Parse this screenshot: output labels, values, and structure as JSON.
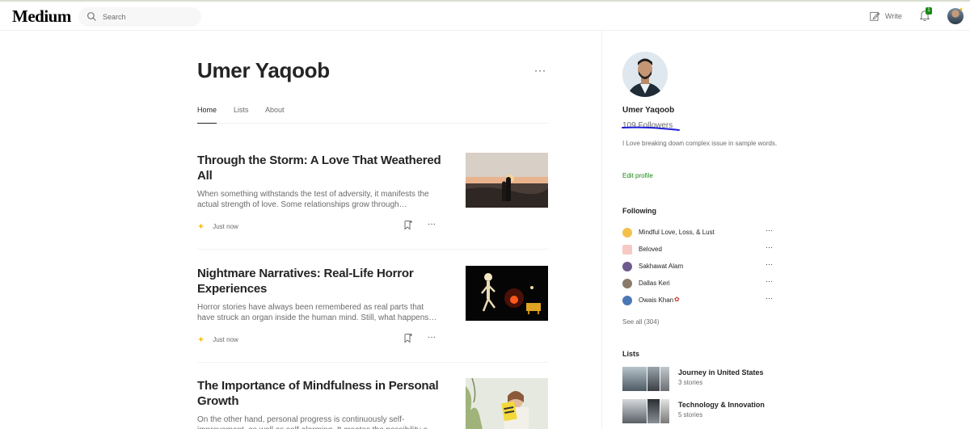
{
  "app": {
    "logo": "Medium"
  },
  "search": {
    "placeholder": "Search"
  },
  "header": {
    "write_label": "Write",
    "notification_count": "1"
  },
  "profile": {
    "name": "Umer Yaqoob",
    "more": "···",
    "tabs": [
      {
        "label": "Home",
        "active": true
      },
      {
        "label": "Lists",
        "active": false
      },
      {
        "label": "About",
        "active": false
      }
    ]
  },
  "posts": [
    {
      "title": "Through the Storm: A Love That Weathered All",
      "excerpt": "When something withstands the test of adversity, it manifests the actual strength of love. Some relationships grow through…",
      "time": "Just now"
    },
    {
      "title": "Nightmare Narratives: Real-Life Horror Experiences",
      "excerpt": "Horror stories have always been remembered as real parts that have struck an organ inside the human mind. Still, what happens…",
      "time": "Just now"
    },
    {
      "title": "The Importance of Mindfulness in Personal Growth",
      "excerpt": "On the other hand, personal progress is continuously self-improvement, as well as self-alarming. It creates the possibility o…",
      "time": ""
    }
  ],
  "post_more": "···",
  "sidebar": {
    "name": "Umer Yaqoob",
    "followers": "109 Followers",
    "bio": "I Love breaking down complex issue in sample words.",
    "edit_profile": "Edit profile",
    "following_heading": "Following",
    "following": [
      {
        "name": "Mindful Love, Loss, & Lust",
        "color": "#f5c04a"
      },
      {
        "name": "Beloved",
        "color": "#f6c9c4"
      },
      {
        "name": "Sakhawat Alam",
        "color": "#6e5a8c"
      },
      {
        "name": "Dallas Keri",
        "color": "#8a7a6a"
      },
      {
        "name": "Owais Khan",
        "color": "#4a78b5"
      }
    ],
    "see_all": "See all (304)",
    "lists_heading": "Lists",
    "lists": [
      {
        "name": "Journey in United States",
        "count": "3 stories"
      },
      {
        "name": "Technology & Innovation",
        "count": "5 stories"
      }
    ]
  },
  "colors": {
    "accent_green": "#1a8917",
    "sparkle": "#ffc017",
    "annotation_underline": "#1e1ed2"
  }
}
